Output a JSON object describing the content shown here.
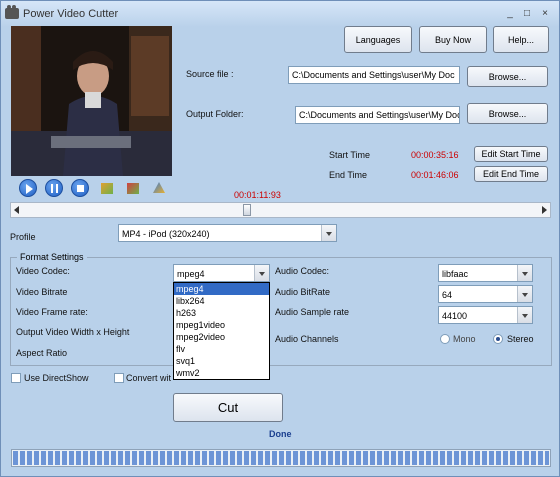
{
  "window": {
    "title": "Power Video Cutter",
    "controls": {
      "minimize": "_",
      "maximize": "□",
      "close": "×"
    }
  },
  "top_buttons": {
    "languages": "Languages",
    "buy_now": "Buy Now",
    "help": "Help..."
  },
  "source": {
    "label": "Source file :",
    "value": "C:\\Documents and Settings\\user\\My Doc",
    "button": "Browse..."
  },
  "output": {
    "label": "Output Folder:",
    "value": "C:\\Documents and Settings\\user\\My Doc",
    "button": "Browse..."
  },
  "times": {
    "start_label": "Start Time",
    "start_value": "00:00:35:16",
    "edit_start": "Edit Start Time",
    "end_label": "End Time",
    "end_value": "00:01:46:06",
    "edit_end": "Edit End Time",
    "current": "00:01:11:93"
  },
  "seek": {
    "position_fraction": 0.43
  },
  "profile": {
    "label": "Profile",
    "value": "MP4 - iPod (320x240)"
  },
  "format": {
    "group_label": "Format Settings",
    "video_codec_label": "Video Codec:",
    "video_codec_value": "mpeg4",
    "video_bitrate_label": "Video Bitrate",
    "video_frame_rate_label": "Video Frame rate:",
    "output_size_label": "Output Video Width x Height",
    "aspect_ratio_label": "Aspect Ratio",
    "codec_options": [
      "mpeg4",
      "libx264",
      "h263",
      "mpeg1video",
      "mpeg2video",
      "flv",
      "svq1",
      "wmv2"
    ],
    "audio_codec_label": "Audio Codec:",
    "audio_codec_value": "libfaac",
    "audio_bitrate_label": "Audio BitRate",
    "audio_bitrate_value": "64",
    "audio_sample_label": "Audio Sample rate",
    "audio_sample_value": "44100",
    "audio_channels_label": "Audio Channels",
    "mono_label": "Mono",
    "stereo_label": "Stereo"
  },
  "options": {
    "use_directshow": "Use DirectShow",
    "convert": "Convert wit"
  },
  "cut_button": "Cut",
  "status": "Done",
  "progress": {
    "fraction": 1.0
  },
  "colors": {
    "window_bg": "#b9d1ea",
    "time_red": "#cc0000",
    "status_blue": "#1a3f8f",
    "highlight": "#316ac5"
  }
}
